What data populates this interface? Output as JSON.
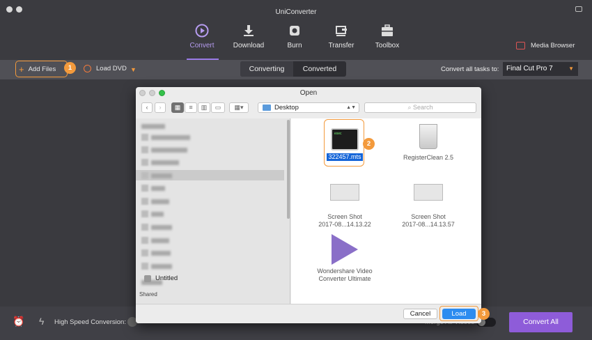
{
  "app": {
    "title": "UniConverter"
  },
  "nav": {
    "items": [
      {
        "label": "Convert",
        "icon": "convert-icon",
        "active": true
      },
      {
        "label": "Download",
        "icon": "download-icon"
      },
      {
        "label": "Burn",
        "icon": "burn-icon"
      },
      {
        "label": "Transfer",
        "icon": "transfer-icon"
      },
      {
        "label": "Toolbox",
        "icon": "toolbox-icon"
      }
    ],
    "media_browser": "Media Browser"
  },
  "toolbar": {
    "add_files": "Add Files",
    "load_dvd": "Load DVD",
    "tabs": [
      "Converting",
      "Converted"
    ],
    "convert_all_label": "Convert all tasks to:",
    "format_value": "Final Cut Pro 7"
  },
  "steps": {
    "one": "1",
    "two": "2",
    "three": "3"
  },
  "bottom": {
    "high_speed": "High Speed Conversion:",
    "merge": "Merge All Videos",
    "convert_all": "Convert All"
  },
  "dialog": {
    "title": "Open",
    "location": "Desktop",
    "search_placeholder": "Search",
    "sidebar": {
      "untitled": "Untitled",
      "shared": "Shared"
    },
    "files": [
      {
        "name": "322457.mts",
        "thumb_text": "exec",
        "selected": true
      },
      {
        "name": "RegisterClean 2.5"
      },
      {
        "name": "Screen Shot",
        "sub": "2017-08...14.13.22"
      },
      {
        "name": "Screen Shot",
        "sub": "2017-08...14.13.57"
      },
      {
        "name": "Wondershare Video",
        "sub": "Converter Ultimate"
      }
    ],
    "cancel": "Cancel",
    "load": "Load"
  },
  "colors": {
    "accent": "#8e5cd9",
    "highlight": "#f39a3c",
    "primary_blue": "#2d8cf0"
  }
}
